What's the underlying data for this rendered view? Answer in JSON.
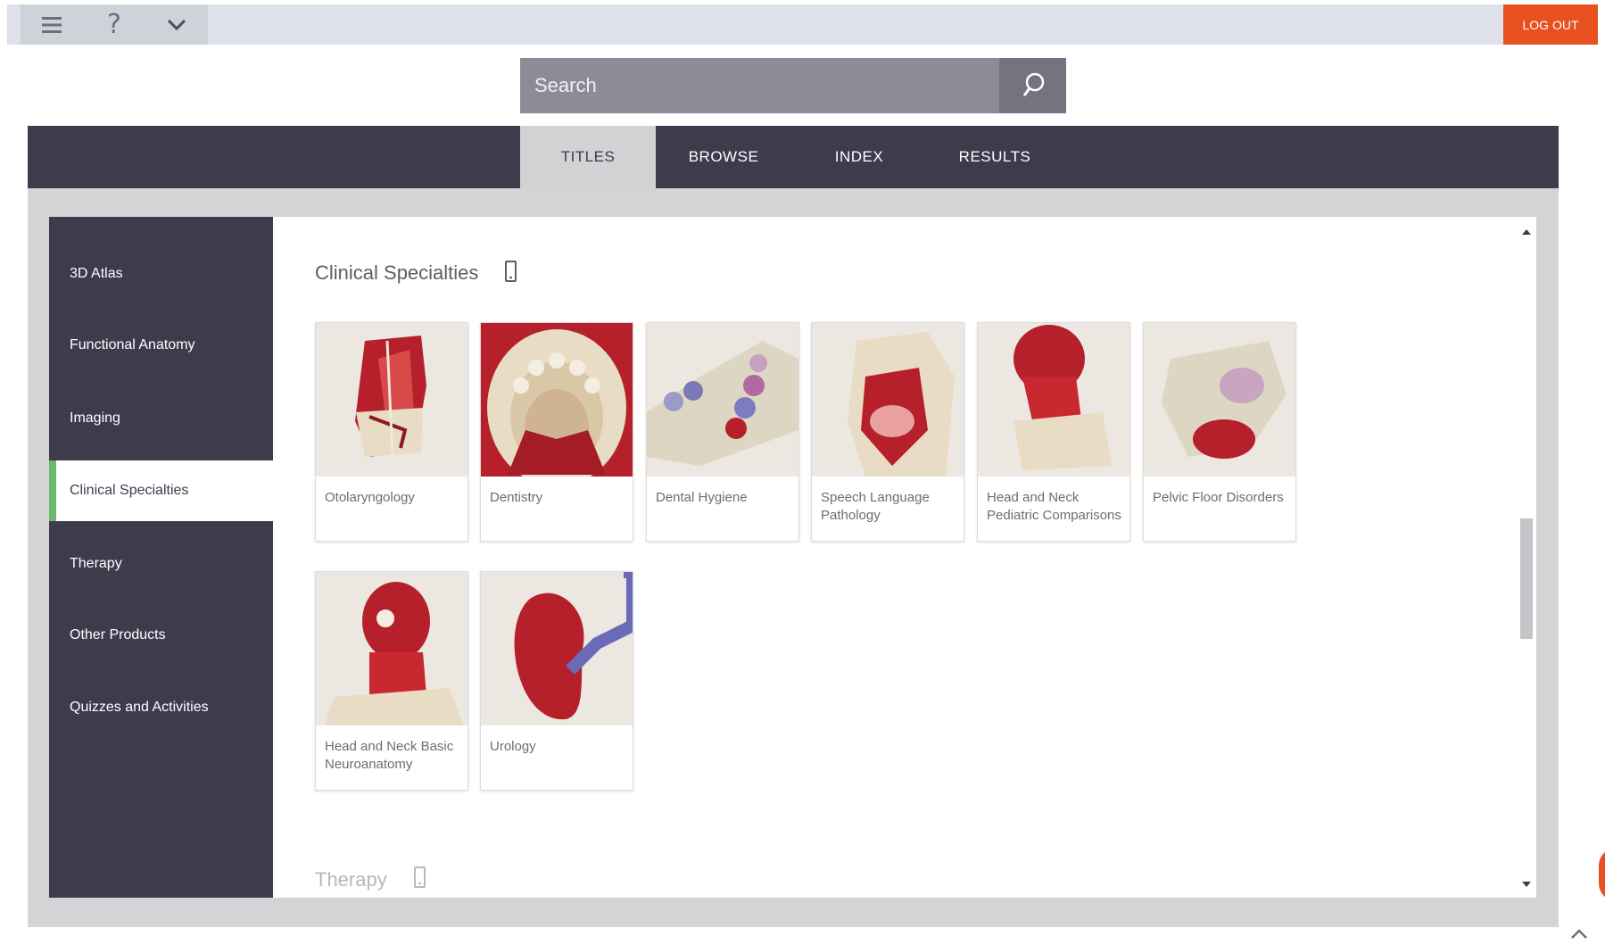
{
  "toolbar": {
    "menu_icon": "hamburger-icon",
    "help_label": "?",
    "dropdown_icon": "chevron-down-icon",
    "logout_label": "LOG OUT",
    "logout_color": "#e8501f"
  },
  "search": {
    "placeholder": "Search",
    "icon": "search-icon"
  },
  "tabs": [
    {
      "label": "TITLES",
      "active": true
    },
    {
      "label": "BROWSE",
      "active": false
    },
    {
      "label": "INDEX",
      "active": false
    },
    {
      "label": "RESULTS",
      "active": false
    }
  ],
  "sidebar": {
    "items": [
      {
        "label": "3D Atlas"
      },
      {
        "label": "Functional Anatomy"
      },
      {
        "label": "Imaging"
      },
      {
        "label": "Clinical Specialties",
        "active": true
      },
      {
        "label": "Therapy"
      },
      {
        "label": "Other Products"
      },
      {
        "label": "Quizzes and Activities"
      }
    ],
    "active_color": "#6ab86b"
  },
  "sections": [
    {
      "title": "Clinical Specialties",
      "icon": "mobile-device-icon",
      "cards": [
        {
          "label": "Otolaryngology"
        },
        {
          "label": "Dentistry"
        },
        {
          "label": "Dental Hygiene"
        },
        {
          "label": "Speech Language Pathology"
        },
        {
          "label": "Head and Neck Pediatric Comparisons"
        },
        {
          "label": "Pelvic Floor Disorders"
        },
        {
          "label": "Head and Neck Basic Neuroanatomy"
        },
        {
          "label": "Urology"
        }
      ]
    },
    {
      "title": "Therapy",
      "icon": "mobile-device-icon"
    }
  ],
  "colors": {
    "nav_dark": "#3e3b4d",
    "muscle_red": "#b5202a",
    "bone": "#e8dcc4"
  }
}
